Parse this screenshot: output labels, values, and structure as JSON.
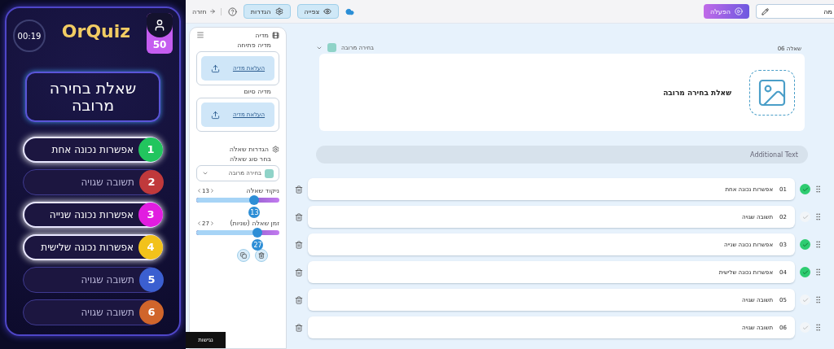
{
  "preview": {
    "timer": "00:19",
    "logo": "OrQuiz",
    "score": "50",
    "question": "שאלת בחירה מרובה",
    "answers": [
      {
        "number": "1",
        "text": "אפשרות נכונה אחת",
        "color": "#22c55e",
        "correct": true
      },
      {
        "number": "2",
        "text": "תשובה שגויה",
        "color": "#c0393b",
        "correct": false
      },
      {
        "number": "3",
        "text": "אפשרות נכונה שנייה",
        "color": "#e11de0",
        "correct": true
      },
      {
        "number": "4",
        "text": "אפשרות נכונה שלישית",
        "color": "#f2c21b",
        "correct": true
      },
      {
        "number": "5",
        "text": "תשובה שגויה",
        "color": "#3b5fd0",
        "correct": false
      },
      {
        "number": "6",
        "text": "תשובה שגויה",
        "color": "#d0652b",
        "correct": false
      }
    ]
  },
  "toolbar": {
    "back": "חזרה",
    "settings": "הגדרות",
    "preview": "צפייה",
    "publish": "הפעלה",
    "title_value": "מה"
  },
  "sidebar": {
    "media_title": "מדיה",
    "opening_label": "מדיה פתיחה",
    "opening_upload": "העלאת מדיה",
    "closing_label": "מדיה סיום",
    "closing_upload": "העלאת מדיה",
    "settings_title": "הגדרות שאלה",
    "type_label": "בחר סוג שאלה",
    "type_value": "בחירה מרובה",
    "sliders": [
      {
        "label": "ניקוד שאלה",
        "value": "13",
        "thumb_value": "13",
        "level": 0.7
      },
      {
        "label": "זמן שאלה (שניות)",
        "value": "27",
        "thumb_value": "27",
        "level": 0.74
      }
    ]
  },
  "accessibility": "נגישות",
  "question": {
    "number_label": "שאלה 06",
    "type": "בחירה מרובה",
    "text": "שאלת בחירה מרובה",
    "additional_placeholder": "Additional Text",
    "answers": [
      {
        "number": "01",
        "text": "אפשרות נכונה אחת",
        "correct": true
      },
      {
        "number": "02",
        "text": "תשובה שגויה",
        "correct": false
      },
      {
        "number": "03",
        "text": "אפשרות נכונה שנייה",
        "correct": true
      },
      {
        "number": "04",
        "text": "אפשרות נכונה שלישית",
        "correct": true
      },
      {
        "number": "05",
        "text": "תשובה שגויה",
        "correct": false
      },
      {
        "number": "06",
        "text": "תשובה שגויה",
        "correct": false
      }
    ]
  }
}
